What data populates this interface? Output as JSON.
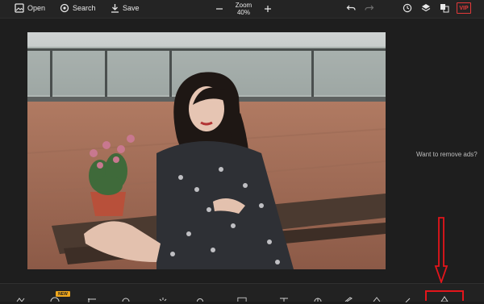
{
  "toolbar": {
    "open_label": "Open",
    "search_label": "Search",
    "save_label": "Save",
    "zoom_label": "Zoom",
    "zoom_value": "40%",
    "vip_label": "VIP"
  },
  "canvas": {
    "ads_text": "Want to remove ads?"
  },
  "bottom_toolbar": {
    "new_badge": "NEW"
  },
  "colors": {
    "background": "#1c1c1c",
    "accent_badge": "#f0a81d",
    "vip_red": "#e43a3a",
    "annotation_red": "#e3151b"
  },
  "icons": [
    "open-icon",
    "search-icon",
    "save-icon",
    "zoom-out-icon",
    "zoom-in-icon",
    "undo-icon",
    "redo-icon",
    "history-icon",
    "layers-icon",
    "translate-icon"
  ]
}
